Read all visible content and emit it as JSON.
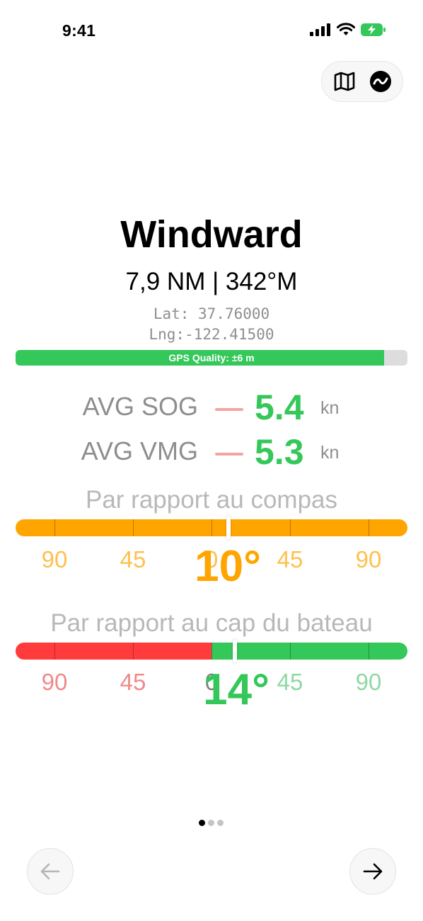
{
  "status": {
    "time": "9:41"
  },
  "toolbar": {
    "map_icon": "map-icon",
    "route_icon": "route-icon"
  },
  "waypoint": {
    "name": "Windward",
    "distance_bearing": "7,9 NM | 342°M",
    "lat": "Lat: 37.76000",
    "lng": "Lng:-122.41500"
  },
  "gps": {
    "label": "GPS Quality: ±6 m",
    "quality": 0.94,
    "color": "#34c759"
  },
  "stats": [
    {
      "label": "AVG SOG",
      "value": "5.4",
      "unit": "kn"
    },
    {
      "label": "AVG VMG",
      "value": "5.3",
      "unit": "kn"
    }
  ],
  "compass_scale": {
    "title": "Par rapport au compas",
    "angle": "10°",
    "color": "#ffa500",
    "ticks": [
      "90",
      "45",
      "0",
      "45",
      "90"
    ]
  },
  "heading_scale": {
    "title": "Par rapport au cap du bateau",
    "angle": "14°",
    "left_color": "#ff3b3b",
    "right_color": "#34c759",
    "ticks": [
      "90",
      "45",
      "0",
      "45",
      "90"
    ]
  },
  "pager": {
    "pages": 3,
    "current": 0
  },
  "nav": {
    "back_icon": "arrow-left-icon",
    "forward_icon": "arrow-right-icon"
  }
}
